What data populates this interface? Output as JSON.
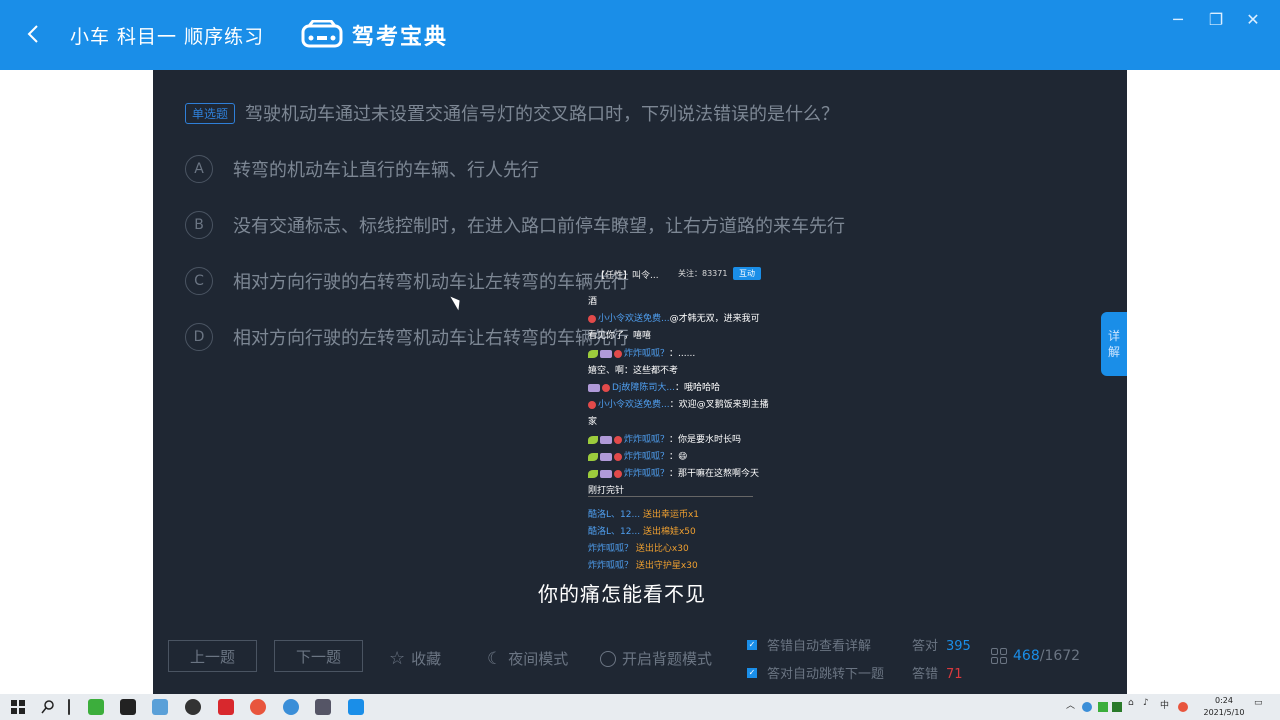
{
  "header": {
    "back_icon": "chevron-left-icon",
    "title": "小车  科目一  顺序练习",
    "logo_text": "驾考宝典",
    "brand_color": "#1a8ee8"
  },
  "window_controls": {
    "minimize": "─",
    "restore": "❐",
    "close": "✕"
  },
  "question": {
    "type_tag": "单选题",
    "text": "驾驶机动车通过未设置交通信号灯的交叉路口时，下列说法错误的是什么？",
    "options": [
      {
        "key": "A",
        "text": "转弯的机动车让直行的车辆、行人先行"
      },
      {
        "key": "B",
        "text": "没有交通标志、标线控制时，在进入路口前停车瞭望，让右方道路的来车先行"
      },
      {
        "key": "C",
        "text": "相对方向行驶的右转弯机动车让左转弯的车辆先行"
      },
      {
        "key": "D",
        "text": "相对方向行驶的左转弯机动车让右转弯的车辆先行"
      }
    ]
  },
  "side_tab": {
    "line1": "详",
    "line2": "解"
  },
  "chat_overlay": {
    "anchor": "【任性】叫令...",
    "follow": "关注：83371",
    "follow_button": "互动",
    "lines": [
      {
        "name": "",
        "text": "酒"
      },
      {
        "name": "小小令欢送免费...",
        "text": "@才韩无双，进来我可"
      },
      {
        "name": "",
        "text": "看见你了，嘻嘻"
      },
      {
        "name": "炸炸呱呱？",
        "text": "：......"
      },
      {
        "name": "",
        "text": "嬉空、啊：这些都不考"
      },
      {
        "name": "Dj故障陈司大...",
        "text": "：哦哈哈哈"
      },
      {
        "name": "小小令欢送免费...",
        "text": "：欢迎@叉鹅饭来到主播"
      },
      {
        "name": "",
        "text": "家"
      },
      {
        "name": "炸炸呱呱？",
        "text": "：你是要水时长吗"
      },
      {
        "name": "炸炸呱呱？",
        "text": "：😄"
      },
      {
        "name": "炸炸呱呱？",
        "text": "：那干嘛在这熬啊今天"
      },
      {
        "name": "",
        "text": "刚打完针"
      }
    ],
    "gifts": [
      {
        "name": "酷洛L、12...",
        "gift": "送出幸运币",
        "count": "x1"
      },
      {
        "name": "酷洛L、12...",
        "gift": "送出棉娃",
        "count": "x50"
      },
      {
        "name": "炸炸呱呱？",
        "gift": "送出比心",
        "count": "x30"
      },
      {
        "name": "炸炸呱呱？",
        "gift": "送出守护星",
        "count": "x30"
      }
    ]
  },
  "subtitle": "你的痛怎能看不见",
  "footer": {
    "prev": "上一题",
    "next": "下一题",
    "favorite": "收藏",
    "night_mode": "夜间模式",
    "background_mode": "开启背题模式",
    "auto_detail": "答错自动查看详解",
    "auto_next": "答对自动跳转下一题",
    "correct_label": "答对",
    "correct_count": "395",
    "wrong_label": "答错",
    "wrong_count": "71",
    "progress_current": "468",
    "progress_total": "/1672"
  },
  "taskbar": {
    "time": "0:24",
    "date": "2021/5/10",
    "ime": "中"
  }
}
